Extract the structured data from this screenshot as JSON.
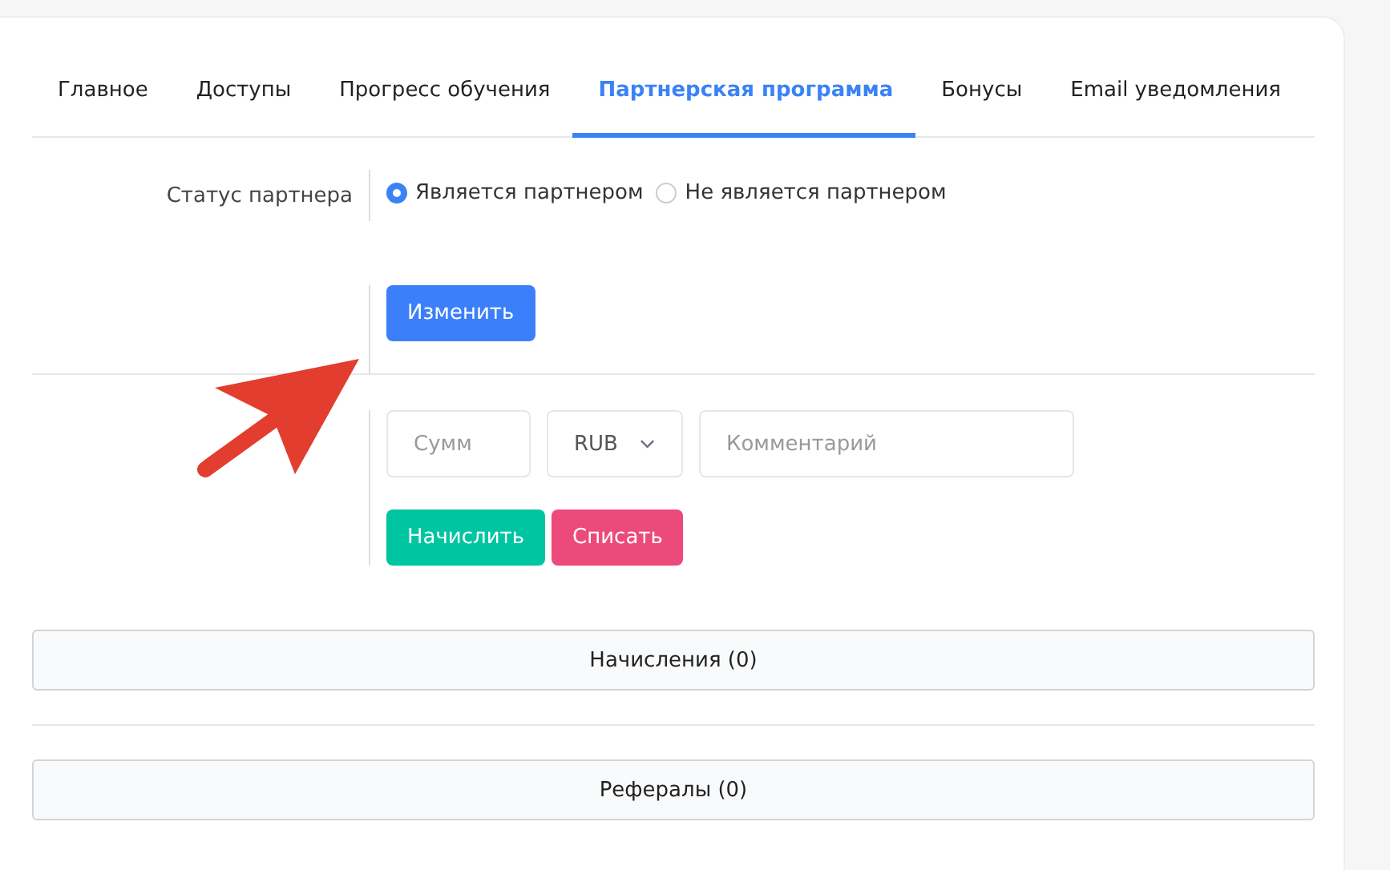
{
  "tabs": [
    {
      "label": "Главное",
      "selected": false
    },
    {
      "label": "Доступы",
      "selected": false
    },
    {
      "label": "Прогресс обучения",
      "selected": false
    },
    {
      "label": "Партнерская программа",
      "selected": true
    },
    {
      "label": "Бонусы",
      "selected": false
    },
    {
      "label": "Email уведомления",
      "selected": false
    }
  ],
  "partner_status": {
    "label": "Статус партнера",
    "options": [
      {
        "label": "Является партнером",
        "selected": true
      },
      {
        "label": "Не является партнером",
        "selected": false
      }
    ]
  },
  "change_button": "Изменить",
  "amount_field": {
    "placeholder": "Сумм"
  },
  "currency_select": {
    "value": "RUB"
  },
  "comment_field": {
    "placeholder": "Комментарий"
  },
  "credit_button": "Начислить",
  "debit_button": "Списать",
  "sections": [
    "Начисления (0)",
    "Рефералы (0)"
  ]
}
